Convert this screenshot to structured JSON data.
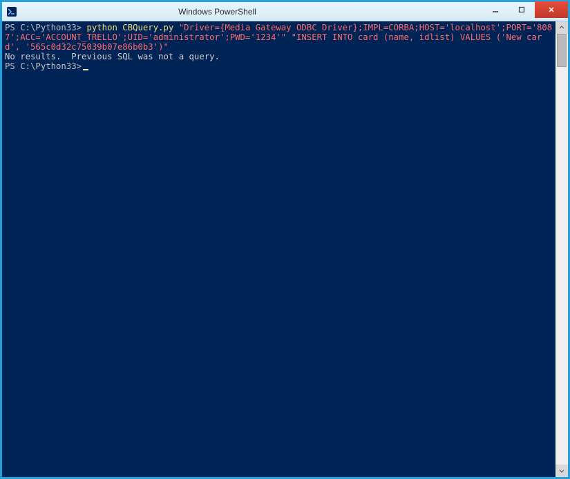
{
  "window": {
    "title": "Windows PowerShell"
  },
  "terminal": {
    "lines": {
      "prompt1": "PS C:\\Python33>",
      "cmd1_word": " python",
      "cmd1_arg": " CBQuery.py",
      "cmd1_rest": " \"Driver={Media Gateway ODBC Driver};IMPL=CORBA;HOST='localhost';PORT='8087';ACC='ACCOUNT_TRELLO';UID='administrator';PWD='1234'\" \"INSERT INTO card (name, idlist) VALUES ('New card', '565c0d32c75039b07e86b0b3')\"",
      "output1": "No results.  Previous SQL was not a query.",
      "prompt2": "PS C:\\Python33>"
    }
  },
  "colors": {
    "terminal_bg": "#012456",
    "terminal_fg": "#d0d0d0",
    "accent": "#26a0da"
  }
}
